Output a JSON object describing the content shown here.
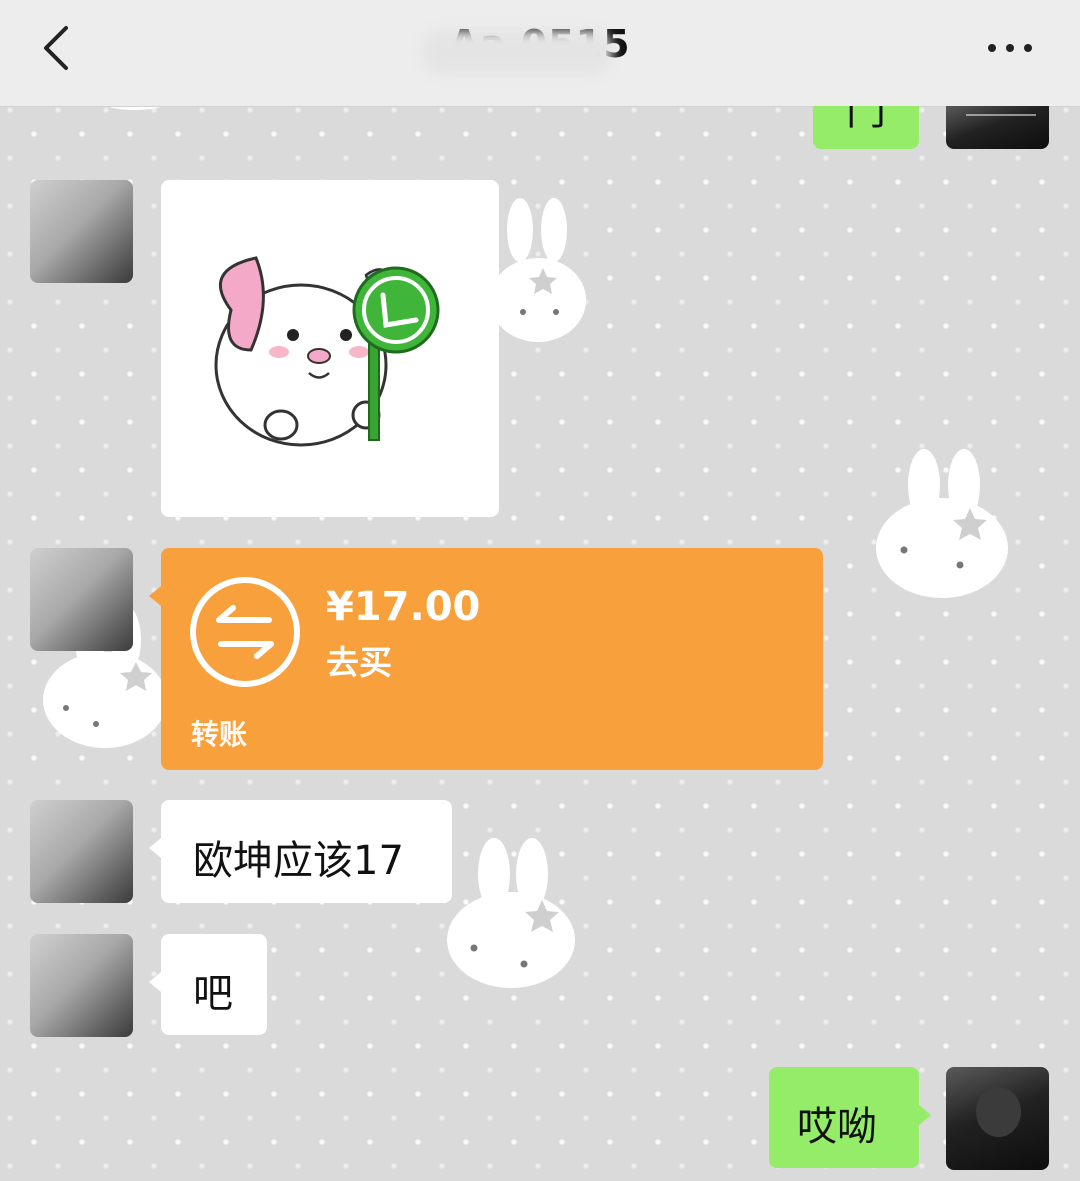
{
  "header": {
    "title": "Aa          0515",
    "back_icon": "chevron-left-icon",
    "more_icon": "more-dots-icon"
  },
  "messages": [
    {
      "from": "self",
      "type": "text",
      "text": "门"
    },
    {
      "from": "other",
      "type": "sticker",
      "sticker": "puppy-holding-check-sign"
    },
    {
      "from": "other",
      "type": "transfer",
      "amount": "¥17.00",
      "action": "去买",
      "label": "转账"
    },
    {
      "from": "other",
      "type": "text",
      "text": "欧坤应该17"
    },
    {
      "from": "other",
      "type": "text",
      "text": "吧"
    },
    {
      "from": "self",
      "type": "text",
      "text": "哎呦"
    }
  ],
  "colors": {
    "header_bg": "#ededed",
    "chat_bg": "#dadada",
    "self_bubble": "#95ec69",
    "other_bubble": "#ffffff",
    "transfer_bg": "#f8a03b"
  }
}
